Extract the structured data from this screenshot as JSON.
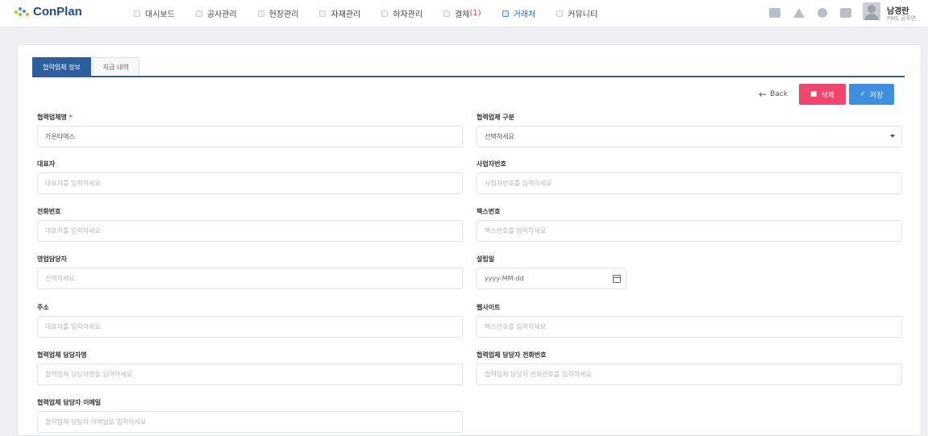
{
  "brand": {
    "name": "ConPlan"
  },
  "nav": [
    {
      "label": "대시보드"
    },
    {
      "label": "공사관리"
    },
    {
      "label": "현장관리"
    },
    {
      "label": "자재관리"
    },
    {
      "label": "하자관리"
    },
    {
      "label": "결제",
      "count": "(1)"
    },
    {
      "label": "거래처",
      "active": true
    },
    {
      "label": "커뮤니티"
    }
  ],
  "user": {
    "name": "남경란",
    "role": "PMS 공주면"
  },
  "tabs": [
    {
      "label": "협력업체 정보",
      "active": true
    },
    {
      "label": "지급 내역"
    }
  ],
  "actions": {
    "back": "Back",
    "delete": "삭제",
    "save": "저장"
  },
  "fields": {
    "company_name": {
      "label": "협력업체명",
      "required": "*",
      "value": "가온타에스"
    },
    "company_type": {
      "label": "협력업체 구분",
      "value": "선택하세요"
    },
    "ceo": {
      "label": "대표자",
      "placeholder": "대표자를 입력하세요"
    },
    "biz_no": {
      "label": "사업자번호",
      "placeholder": "사업자번호를 입력하세요"
    },
    "phone": {
      "label": "전화번호",
      "placeholder": "대표자를 입력하세요"
    },
    "fax": {
      "label": "팩스번호",
      "placeholder": "팩스번호를 입력하세요"
    },
    "sales_manager": {
      "label": "영업담당자",
      "placeholder": "선택하세요"
    },
    "founded": {
      "label": "설립일",
      "placeholder": "yyyy-MM-dd"
    },
    "address": {
      "label": "주소",
      "placeholder": "대표자를 입력하세요"
    },
    "website": {
      "label": "웹사이트",
      "placeholder": "팩스번호를 입력하세요"
    },
    "contact_name": {
      "label": "협력업체 담당자명",
      "placeholder": "협력업체 담당자명을 입력하세요"
    },
    "contact_phone": {
      "label": "협력업체 담당자 전화번호",
      "placeholder": "협력업체 담당자 전화번호를 입력하세요"
    },
    "contact_email": {
      "label": "협력업체 담당자 이메일",
      "placeholder": "협력업체 담당자 이메일을 입력하세요"
    }
  },
  "icons": {
    "nav_icons": [
      "dashboard-icon",
      "construction-icon",
      "site-icon",
      "material-icon",
      "defect-icon",
      "payment-icon",
      "client-icon",
      "community-icon"
    ],
    "top_icons": [
      "document-icon",
      "send-icon",
      "users-icon",
      "card-icon"
    ]
  },
  "colors": {
    "primary": "#2d5e9e",
    "danger": "#f0466e",
    "save": "#3f8fe0",
    "logo": "#1f4b8f"
  }
}
